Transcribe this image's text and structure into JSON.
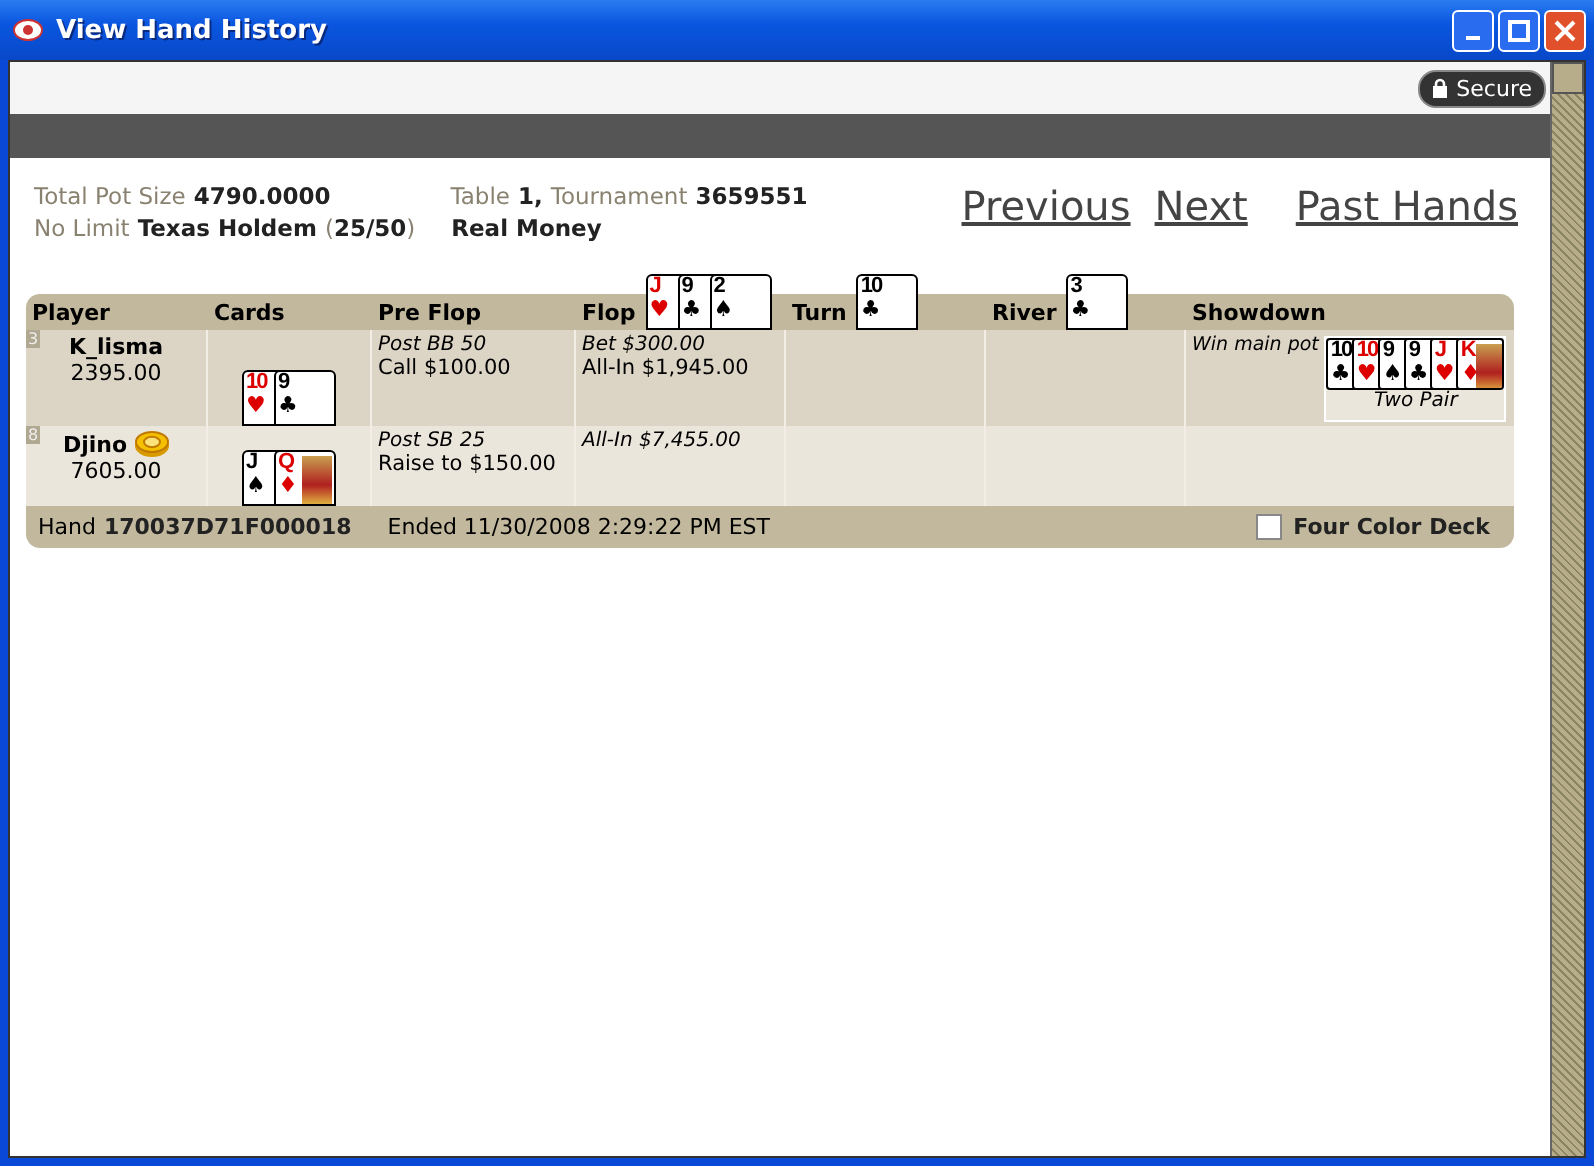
{
  "window": {
    "title": "View Hand History"
  },
  "secure_badge": {
    "label": "Secure"
  },
  "summary": {
    "pot_label": "Total Pot Size",
    "pot": "4790.0000",
    "limit": "No Limit",
    "game": "Texas Holdem",
    "blinds_open": "(",
    "blinds": "25/50",
    "blinds_close": ")",
    "table_label": "Table",
    "table": "1",
    "comma": ",",
    "tournament_label": "Tournament",
    "tournament": "3659551",
    "money": "Real Money"
  },
  "nav_links": [
    "Previous",
    "Next",
    "Past Hands"
  ],
  "table": {
    "columns": [
      {
        "label": "Player"
      },
      {
        "label": "Cards"
      },
      {
        "label": "Pre Flop"
      },
      {
        "label": "Flop",
        "cards": [
          {
            "rank": "J",
            "suit": "♥"
          },
          {
            "rank": "9",
            "suit": "♣"
          },
          {
            "rank": "2",
            "suit": "♠"
          }
        ]
      },
      {
        "label": "Turn",
        "cards": [
          {
            "rank": "10",
            "suit": "♣"
          }
        ]
      },
      {
        "label": "River",
        "cards": [
          {
            "rank": "3",
            "suit": "♣"
          }
        ]
      },
      {
        "label": "Showdown"
      }
    ],
    "rows": [
      {
        "seat": "3",
        "name": "K_lisma",
        "dealer": false,
        "stack": "2395.00",
        "cards": [
          {
            "rank": "10",
            "suit": "♥"
          },
          {
            "rank": "9",
            "suit": "♣"
          }
        ],
        "preflop": [
          "Post BB 50",
          "Call $100.00"
        ],
        "flop": [
          "Bet $300.00",
          "All-In $1,945.00"
        ],
        "turn": [],
        "river": [],
        "showdown": {
          "result": "Win main pot",
          "cards": [
            {
              "rank": "10",
              "suit": "♣"
            },
            {
              "rank": "10",
              "suit": "♥"
            },
            {
              "rank": "9",
              "suit": "♠"
            },
            {
              "rank": "9",
              "suit": "♣"
            },
            {
              "rank": "J",
              "suit": "♥"
            },
            {
              "rank": "K",
              "suit": "♦"
            }
          ],
          "hand": "Two Pair"
        }
      },
      {
        "seat": "8",
        "name": "Djino",
        "dealer": true,
        "stack": "7605.00",
        "cards": [
          {
            "rank": "J",
            "suit": "♠"
          },
          {
            "rank": "Q",
            "suit": "♦"
          }
        ],
        "preflop": [
          "Post SB 25",
          "Raise to $150.00"
        ],
        "flop": [
          "All-In $7,455.00"
        ],
        "turn": [],
        "river": [],
        "showdown": null
      }
    ],
    "footer": {
      "hand_label": "Hand",
      "hand_id": "170037D71F000018",
      "ended": "Ended 11/30/2008 2:29:22 PM EST",
      "four_color_deck": {
        "label": "Four Color Deck",
        "checked": false
      }
    }
  }
}
